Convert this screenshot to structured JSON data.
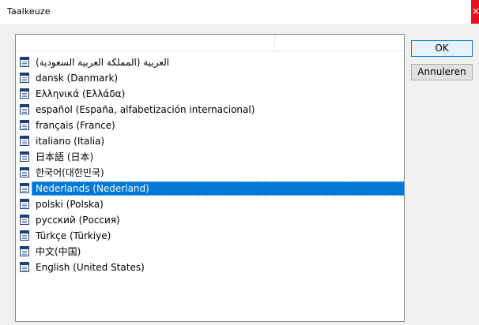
{
  "window": {
    "title": "Taalkeuze",
    "close_glyph": "×"
  },
  "list": {
    "columns": [
      "",
      ""
    ],
    "items": [
      {
        "label": "(العربية (المملكة العربية السعودية",
        "selected": false
      },
      {
        "label": "dansk (Danmark)",
        "selected": false
      },
      {
        "label": "Ελληνικά (Ελλάδα)",
        "selected": false
      },
      {
        "label": "español (España, alfabetización internacional)",
        "selected": false
      },
      {
        "label": "français (France)",
        "selected": false
      },
      {
        "label": "italiano (Italia)",
        "selected": false
      },
      {
        "label": "日本語 (日本)",
        "selected": false
      },
      {
        "label": "한국어(대한민국)",
        "selected": false
      },
      {
        "label": "Nederlands (Nederland)",
        "selected": true
      },
      {
        "label": "polski (Polska)",
        "selected": false
      },
      {
        "label": "русский (Россия)",
        "selected": false
      },
      {
        "label": "Türkçe (Türkiye)",
        "selected": false
      },
      {
        "label": "中文(中国)",
        "selected": false
      },
      {
        "label": "English (United States)",
        "selected": false
      }
    ],
    "item_icon": "language-file-icon"
  },
  "buttons": {
    "ok_label": "OK",
    "cancel_label": "Annuleren"
  },
  "colors": {
    "selection": "#0078d7",
    "close_button": "#e81123",
    "default_button_border": "#0078d7"
  }
}
